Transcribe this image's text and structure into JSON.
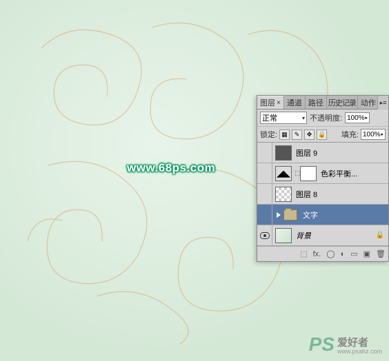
{
  "canvas": {
    "watermark_url": "www.68ps.com",
    "logo_ps": "PS",
    "logo_cn": "爱好者",
    "logo_url": "www.psahz.com"
  },
  "panel": {
    "tabs": {
      "layers": "图层",
      "channels": "通道",
      "paths": "路径",
      "history": "历史记录",
      "actions": "动作",
      "close_x": "×"
    },
    "blend_mode": "正常",
    "opacity_label": "不透明度:",
    "opacity_value": "100%",
    "lock_label": "锁定:",
    "fill_label": "填充:",
    "fill_value": "100%",
    "layers": [
      {
        "name": "图层 9",
        "type": "raster-gray"
      },
      {
        "name": "色彩平衡...",
        "type": "adjustment"
      },
      {
        "name": "图层 8",
        "type": "raster-checker"
      },
      {
        "name": "文字",
        "type": "group"
      },
      {
        "name": "背景",
        "type": "background"
      }
    ],
    "footer_icons": {
      "link": "⬚",
      "fx": "fx.",
      "mask": "◯",
      "adj": "◐",
      "folder": "▭",
      "new": "▣",
      "trash": "🗑"
    }
  }
}
